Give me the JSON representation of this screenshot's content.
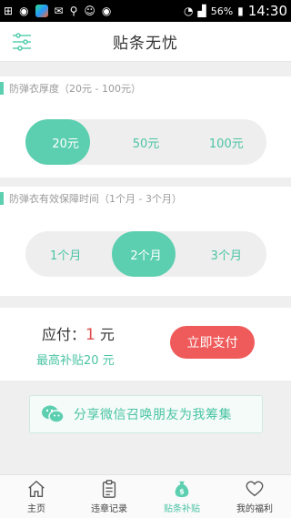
{
  "status_bar": {
    "battery": "56%",
    "time": "14:30"
  },
  "header": {
    "title": "贴条无忧"
  },
  "armor": {
    "label": "防弹衣厚度（20元 - 100元）",
    "options": [
      "20元",
      "50元",
      "100元"
    ],
    "selected": "20元"
  },
  "duration": {
    "label": "防弹衣有效保障时间（1个月 - 3个月）",
    "options": [
      "1个月",
      "2个月",
      "3个月"
    ],
    "selected": "2个月"
  },
  "payment": {
    "due_label": "应付：",
    "due_amount": "1",
    "due_unit": " 元",
    "subsidy": "最高补贴20 元",
    "pay_button": "立即支付"
  },
  "share": {
    "text": "分享微信召唤朋友为我筹集"
  },
  "tabs": [
    {
      "label": "主页",
      "icon": "home-icon"
    },
    {
      "label": "违章记录",
      "icon": "clipboard-icon"
    },
    {
      "label": "贴条补贴",
      "icon": "money-bag-icon",
      "active": true
    },
    {
      "label": "我的福利",
      "icon": "heart-icon"
    }
  ],
  "colors": {
    "accent": "#5ccfb0",
    "pay_button": "#ef5a5a",
    "amount": "#e14b4b"
  }
}
